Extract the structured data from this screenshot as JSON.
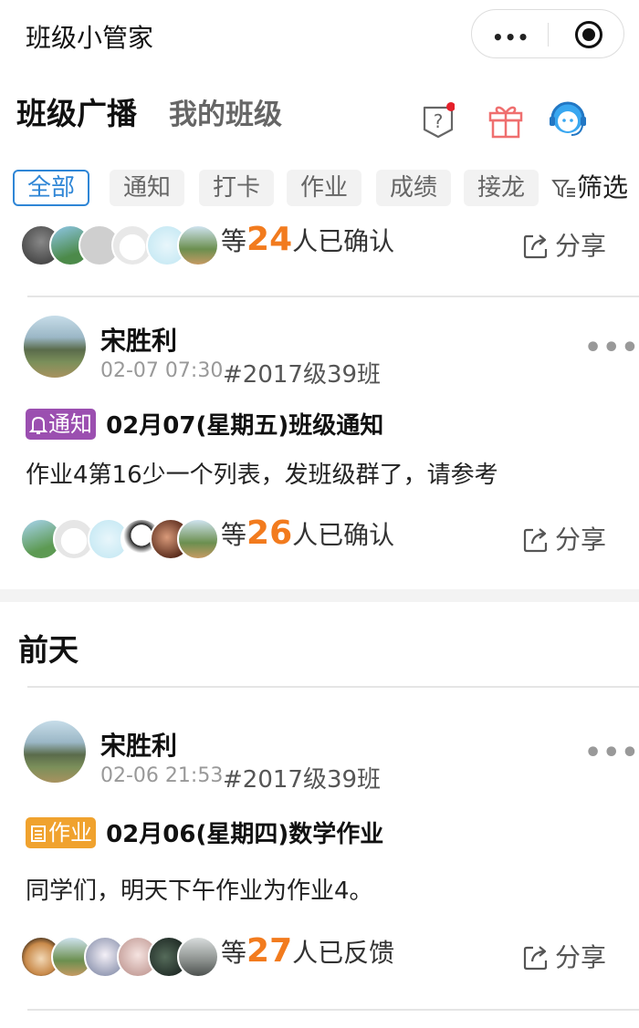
{
  "app": {
    "title": "班级小管家"
  },
  "header": {
    "tabs": [
      {
        "label": "班级广播"
      },
      {
        "label": "我的班级"
      }
    ]
  },
  "filters": {
    "chips": [
      {
        "label": "全部"
      },
      {
        "label": "通知"
      },
      {
        "label": "打卡"
      },
      {
        "label": "作业"
      },
      {
        "label": "成绩"
      },
      {
        "label": "接龙"
      }
    ],
    "filter_label": "筛选"
  },
  "colors": {
    "accent": "#2f86d6",
    "count": "#f27b1e",
    "notice_tag": "#9b4fb0",
    "homework_tag": "#f0a22e",
    "badge_dot": "#e5202a"
  },
  "top_post_footer": {
    "prefix": "等",
    "count": "24",
    "suffix": "人已确认",
    "share_label": "分享"
  },
  "posts": [
    {
      "author": "宋胜利",
      "time": "02-07 07:30",
      "class_tag": "#2017级39班",
      "tag_label": "通知",
      "tag_icon": "bell-icon",
      "title": "02月07(星期五)班级通知",
      "body": "作业4第16少一个列表，发班级群了，请参考",
      "footer": {
        "prefix": "等",
        "count": "26",
        "suffix": "人已确认",
        "share_label": "分享"
      }
    },
    {
      "author": "宋胜利",
      "time": "02-06 21:53",
      "class_tag": "#2017级39班",
      "tag_label": "作业",
      "tag_icon": "list-icon",
      "title": "02月06(星期四)数学作业",
      "body": "同学们，明天下午作业为作业4。",
      "footer": {
        "prefix": "等",
        "count": "27",
        "suffix": "人已反馈",
        "share_label": "分享"
      }
    }
  ],
  "day_sections": [
    {
      "label": "前天"
    }
  ]
}
